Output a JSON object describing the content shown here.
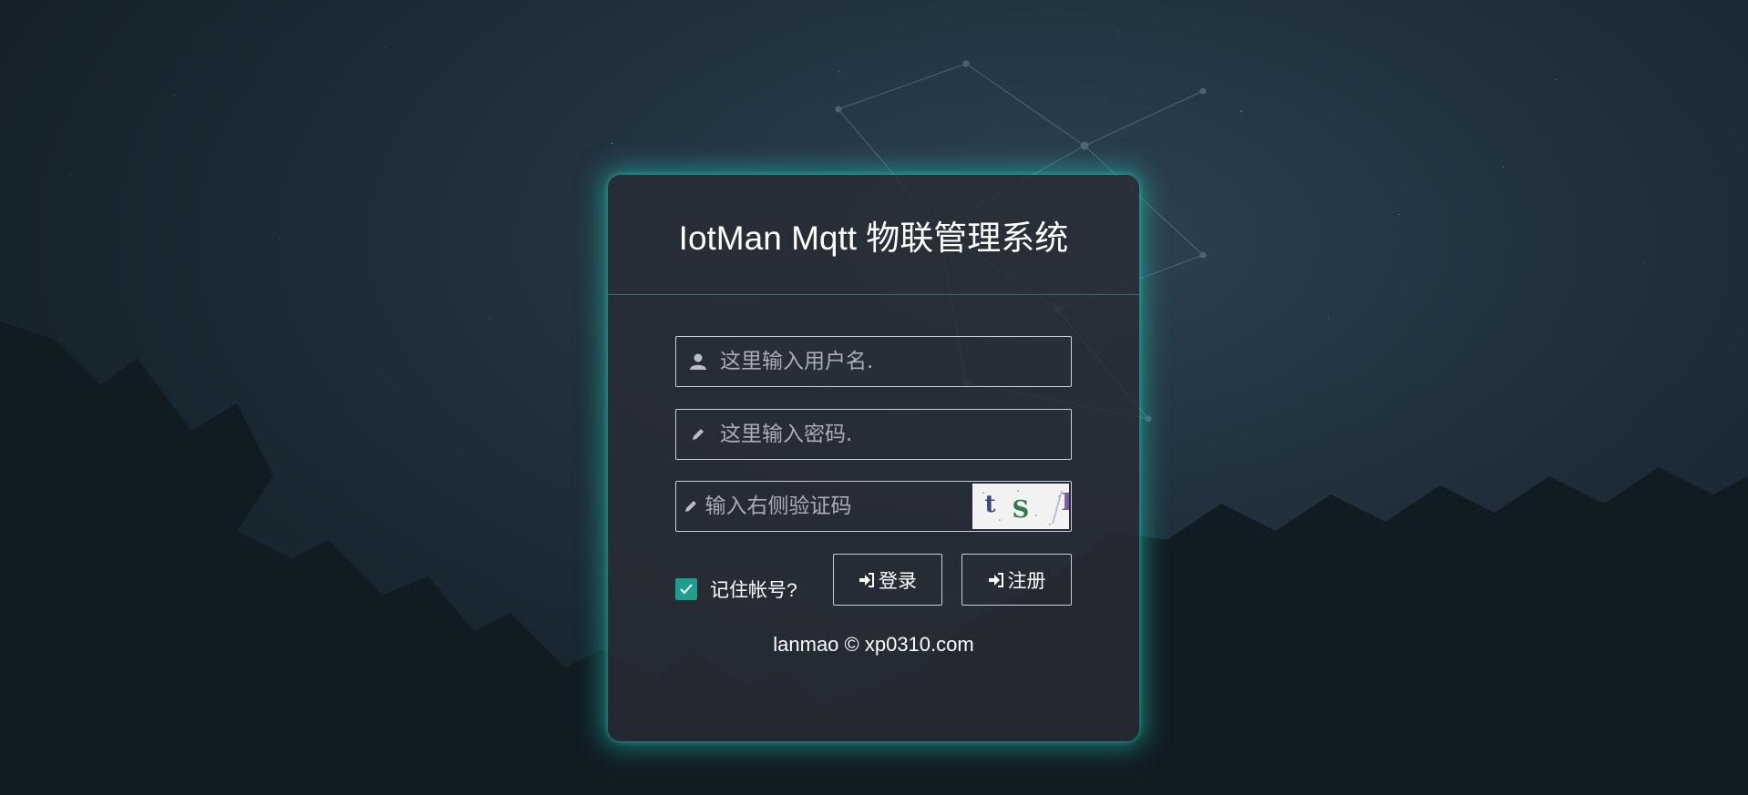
{
  "title": "IotMan Mqtt 物联管理系统",
  "form": {
    "username_placeholder": "这里输入用户名.",
    "password_placeholder": "这里输入密码.",
    "captcha_placeholder": "输入右侧验证码",
    "captcha_chars": [
      "t",
      "S",
      "L",
      "d"
    ],
    "remember_label": "记住帐号?",
    "remember_checked": true,
    "login_label": "登录",
    "register_label": "注册"
  },
  "footer": "lanmao © xp0310.com",
  "icons": {
    "username": "user-icon",
    "password": "pencil-icon",
    "captcha": "pencil-icon",
    "login": "sign-in-icon",
    "register": "sign-in-icon",
    "remember": "checkmark-icon"
  },
  "colors": {
    "accent": "#1f9e8f",
    "glow": "#20c8b4",
    "card": "#282c34"
  }
}
